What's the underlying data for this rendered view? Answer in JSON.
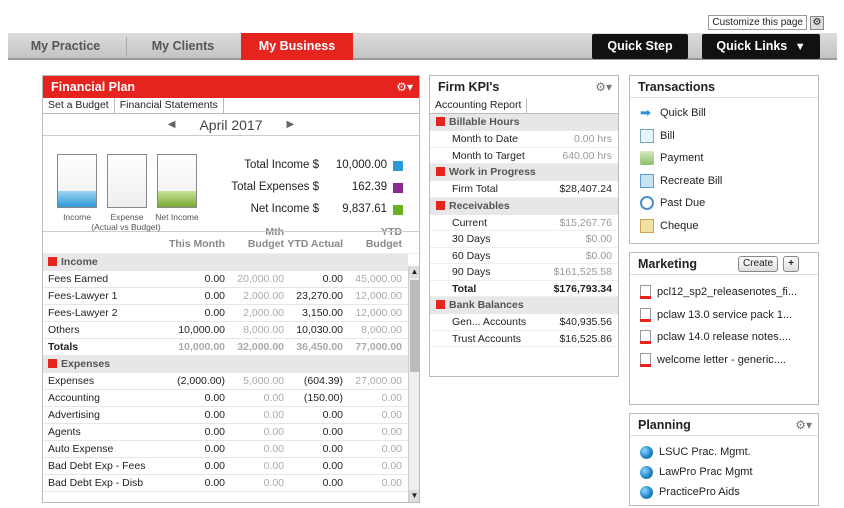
{
  "customize": {
    "label": "Customize this page"
  },
  "nav": {
    "tabs": [
      "My Practice",
      "My Clients",
      "My Business"
    ],
    "quick_step": "Quick Step",
    "quick_links": "Quick Links"
  },
  "financial_plan": {
    "title": "Financial Plan",
    "tabs": [
      "Set a Budget",
      "Financial Statements"
    ],
    "month": "April 2017",
    "jar_caption_income": "Income",
    "jar_caption_expense": "Expense",
    "jar_caption_net": "Net Income",
    "jar_caption_sub": "(Actual vs Budget)",
    "total_income_label": "Total Income $",
    "total_income_value": "10,000.00",
    "total_expenses_label": "Total Expenses $",
    "total_expenses_value": "162.39",
    "net_income_label": "Net Income $",
    "net_income_value": "9,837.61",
    "columns": [
      "This Month",
      "Mth Budget",
      "YTD Actual",
      "YTD Budget"
    ],
    "income_label": "Income",
    "income_rows": [
      [
        "Fees Earned",
        "0.00",
        "20,000.00",
        "0.00",
        "45,000.00"
      ],
      [
        "Fees-Lawyer 1",
        "0.00",
        "2,000.00",
        "23,270.00",
        "12,000.00"
      ],
      [
        "Fees-Lawyer 2",
        "0.00",
        "2,000.00",
        "3,150.00",
        "12,000.00"
      ],
      [
        "Others",
        "10,000.00",
        "8,000.00",
        "10,030.00",
        "8,000.00"
      ],
      [
        "Totals",
        "10,000.00",
        "32,000.00",
        "36,450.00",
        "77,000.00"
      ]
    ],
    "expenses_label": "Expenses",
    "expense_rows": [
      [
        "Expenses",
        "(2,000.00)",
        "5,000.00",
        "(604.39)",
        "27,000.00"
      ],
      [
        "Accounting",
        "0.00",
        "0.00",
        "(150.00)",
        "0.00"
      ],
      [
        "Advertising",
        "0.00",
        "0.00",
        "0.00",
        "0.00"
      ],
      [
        "Agents",
        "0.00",
        "0.00",
        "0.00",
        "0.00"
      ],
      [
        "Auto Expense",
        "0.00",
        "0.00",
        "0.00",
        "0.00"
      ],
      [
        "Bad Debt Exp - Fees",
        "0.00",
        "0.00",
        "0.00",
        "0.00"
      ],
      [
        "Bad Debt Exp - Disb",
        "0.00",
        "0.00",
        "0.00",
        "0.00"
      ]
    ]
  },
  "kpi": {
    "title": "Firm KPI's",
    "tab": "Accounting Report",
    "sections": [
      {
        "label": "Billable Hours",
        "rows": [
          [
            "Month to Date",
            "0.00 hrs"
          ],
          [
            "Month to Target",
            "640.00 hrs"
          ]
        ]
      },
      {
        "label": "Work in Progress",
        "rows": [
          [
            "Firm Total",
            "$28,407.24"
          ]
        ]
      },
      {
        "label": "Receivables",
        "rows": [
          [
            "Current",
            "$15,267.76"
          ],
          [
            "30 Days",
            "$0.00"
          ],
          [
            "60 Days",
            "$0.00"
          ],
          [
            "90 Days",
            "$161,525.58"
          ],
          [
            "Total",
            "$176,793.34"
          ]
        ]
      },
      {
        "label": "Bank Balances",
        "rows": [
          [
            "Gen... Accounts",
            "$40,935.56"
          ],
          [
            "Trust Accounts",
            "$16,525.86"
          ]
        ]
      }
    ]
  },
  "transactions": {
    "title": "Transactions",
    "items": [
      "Quick Bill",
      "Bill",
      "Payment",
      "Recreate Bill",
      "Past Due",
      "Cheque"
    ]
  },
  "marketing": {
    "title": "Marketing",
    "create": "Create",
    "plus": "+",
    "items": [
      "pcl12_sp2_releasenotes_fi...",
      "pclaw 13.0 service pack 1...",
      "pclaw 14.0 release notes....",
      "welcome letter - generic...."
    ]
  },
  "planning": {
    "title": "Planning",
    "items": [
      "LSUC Prac. Mgmt.",
      "LawPro Prac Mgmt",
      "PracticePro Aids"
    ]
  },
  "colors": {
    "accent": "#e5241f",
    "income_jar": "#2f9ad8",
    "net_jar": "#7aaa33",
    "kpi_good": "#222"
  },
  "progress": {
    "income_jar_fill": 0.31,
    "expense_jar_fill": 0.0,
    "net_jar_fill": 0.31
  }
}
